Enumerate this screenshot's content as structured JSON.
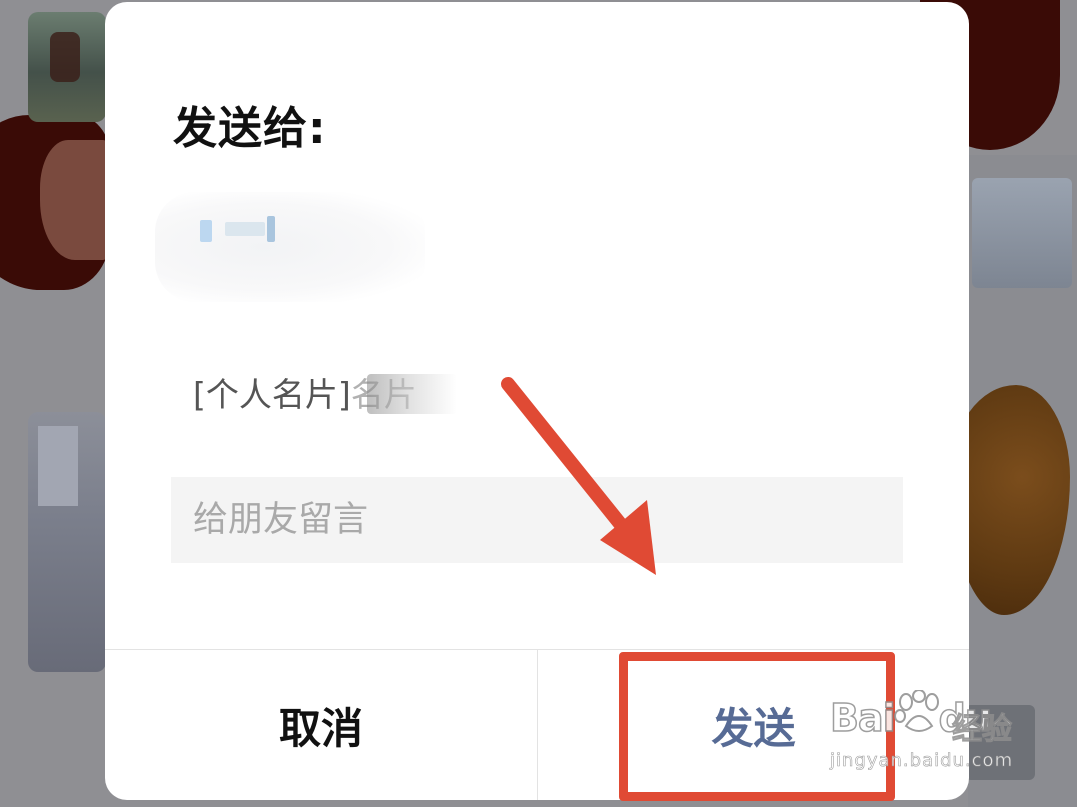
{
  "dialog": {
    "title": "发送给:",
    "card_preview": "[个人名片]",
    "card_preview_fragment": "名片",
    "message_placeholder": "给朋友留言",
    "cancel_label": "取消",
    "send_label": "发送"
  },
  "watermark": {
    "logo_text": "Bai",
    "logo_text_2": "du",
    "label": "经验",
    "url": "jingyan.baidu.com"
  },
  "colors": {
    "send_accent": "#576b95",
    "annotation_red": "#e04a34",
    "dim_overlay": "#8f8f93"
  },
  "icons": {
    "annotation_arrow": "arrow-down-right-icon",
    "watermark_paw": "baidu-paw-icon"
  }
}
